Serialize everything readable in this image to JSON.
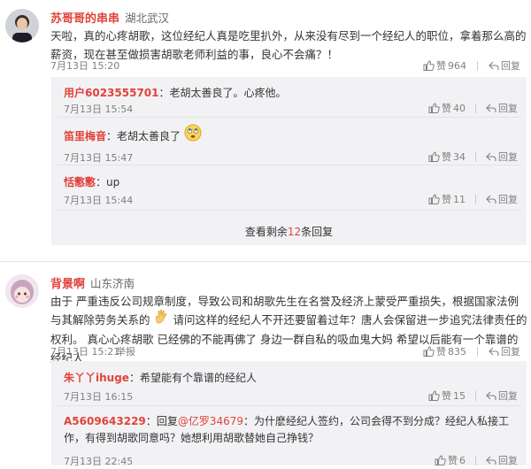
{
  "comment1": {
    "username": "苏哥哥的串串",
    "location": "湖北武汉",
    "text": "天啦，真的心疼胡歌，这位经纪人真是吃里扒外，从来没有尽到一个经纪人的职位，拿着那么高的薪资，现在甚至做损害胡歌老师利益的事，良心不会痛？！",
    "time": "7月13日 15:20",
    "likes": "964",
    "reply_label": "回复",
    "replies": [
      {
        "name": "用户6023555701",
        "sep": "：",
        "text": "老胡太善良了。心疼他。",
        "time": "7月13日 15:54",
        "likes": "40",
        "reply_label": "回复"
      },
      {
        "name": "笛里梅音",
        "sep": "：",
        "text": "老胡太善良了",
        "time": "7月13日 15:47",
        "likes": "34",
        "reply_label": "回复"
      },
      {
        "name": "恬懯懯",
        "sep": "：",
        "text": "up",
        "time": "7月13日 15:44",
        "likes": "11",
        "reply_label": "回复"
      }
    ],
    "more_prefix": "查看剩余",
    "more_count": "12",
    "more_suffix": "条回复"
  },
  "comment2": {
    "username": "背景啊",
    "location": "山东济南",
    "text_a": "由于 严重违反公司规章制度，导致公司和胡歌先生在名誉及经济上蒙受严重损失，根据国家法例与其解除劳务关系的",
    "text_b": "请问这样的经纪人不开还要留着过年？唐人会保留进一步追究法律责任的权利。 真心心疼胡歌 已经佛的不能再佛了 身边一群自私的吸血鬼大妈 希望以后能有一个靠谱的经纪人",
    "time": "7月13日 15:21",
    "report": "举报",
    "likes": "835",
    "reply_label": "回复",
    "replies": [
      {
        "name": "朱丫丫ihuge",
        "sep": "：",
        "text": "希望能有个靠谱的经纪人",
        "time": "7月13日 16:15",
        "likes": "15",
        "reply_label": "回复"
      },
      {
        "name": "A5609643229",
        "sep": "：",
        "pre": "回复",
        "mention": "@亿罗34679",
        "text": "：为什麽经纪人签约，公司会得不到分成？经纪人私接工作，有得到胡歌同意吗？她想利用胡歌替她自己挣钱？",
        "time": "7月13日 22:45",
        "likes": "6",
        "reply_label": "回复"
      }
    ]
  },
  "icons": {
    "like": "thumbs-up-icon",
    "reply": "reply-arrow-icon"
  }
}
